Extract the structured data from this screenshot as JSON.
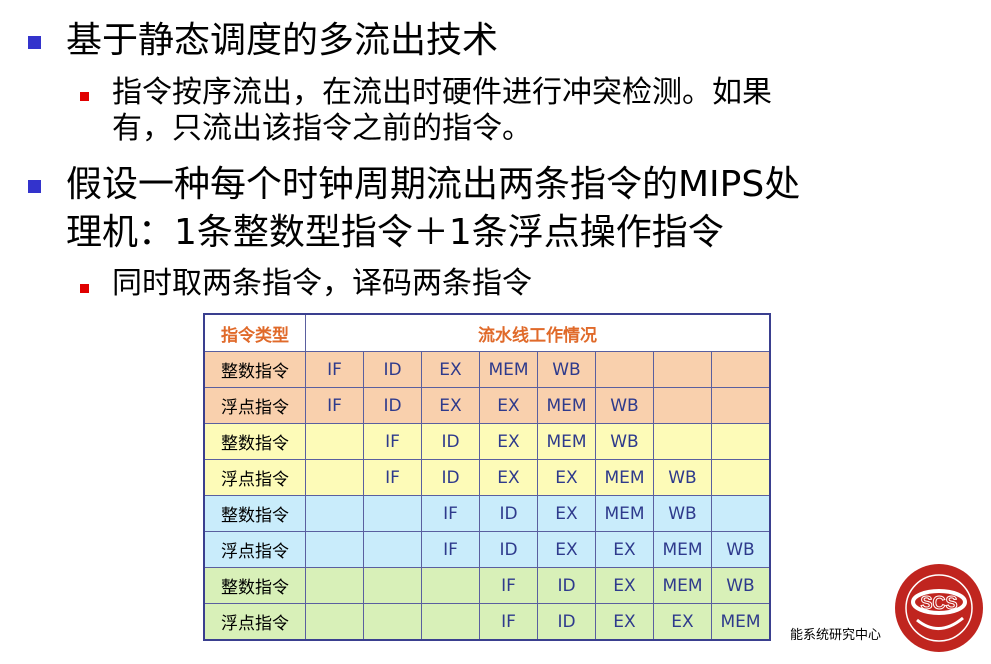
{
  "bullets": [
    {
      "level": 1,
      "lines": [
        "基于静态调度的多流出技术"
      ]
    },
    {
      "level": 2,
      "lines": [
        "指令按序流出，在流出时硬件进行冲突检测。如果",
        "有，只流出该指令之前的指令。"
      ]
    },
    {
      "level": 1,
      "lines": [
        "假设一种每个时钟周期流出两条指令的MIPS处",
        "理机：1条整数型指令＋1条浮点操作指令"
      ]
    },
    {
      "level": 2,
      "lines": [
        "同时取两条指令，译码两条指令"
      ]
    }
  ],
  "table": {
    "headers": [
      "指令类型",
      "流水线工作情况"
    ],
    "rows": [
      {
        "type": "整数指令",
        "color": "#f9d0ad",
        "stages": [
          "IF",
          "ID",
          "EX",
          "MEM",
          "WB",
          "",
          "",
          ""
        ]
      },
      {
        "type": "浮点指令",
        "color": "#f9d0ad",
        "stages": [
          "IF",
          "ID",
          "EX",
          "EX",
          "MEM",
          "WB",
          "",
          ""
        ]
      },
      {
        "type": "整数指令",
        "color": "#fdfbb8",
        "stages": [
          "",
          "IF",
          "ID",
          "EX",
          "MEM",
          "WB",
          "",
          ""
        ]
      },
      {
        "type": "浮点指令",
        "color": "#fdfbb8",
        "stages": [
          "",
          "IF",
          "ID",
          "EX",
          "EX",
          "MEM",
          "WB",
          ""
        ]
      },
      {
        "type": "整数指令",
        "color": "#c9ecfb",
        "stages": [
          "",
          "",
          "IF",
          "ID",
          "EX",
          "MEM",
          "WB",
          ""
        ]
      },
      {
        "type": "浮点指令",
        "color": "#c9ecfb",
        "stages": [
          "",
          "",
          "IF",
          "ID",
          "EX",
          "EX",
          "MEM",
          "WB"
        ]
      },
      {
        "type": "整数指令",
        "color": "#d8f0b8",
        "stages": [
          "",
          "",
          "",
          "IF",
          "ID",
          "EX",
          "MEM",
          "WB"
        ]
      },
      {
        "type": "浮点指令",
        "color": "#d8f0b8",
        "stages": [
          "",
          "",
          "",
          "IF",
          "ID",
          "EX",
          "EX",
          "MEM"
        ]
      }
    ]
  },
  "footer": "能系统研究中心",
  "logo": {
    "text": "SCS",
    "color": "#c0251f"
  }
}
